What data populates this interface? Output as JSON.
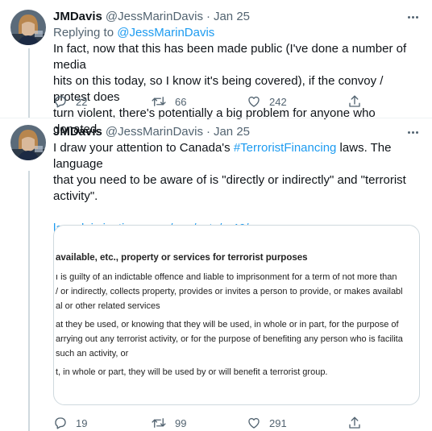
{
  "tweets": [
    {
      "author_name": "JMDavis",
      "author_handle": "@JessMarinDavis",
      "separator": "·",
      "date": "Jan 25",
      "replying_prefix": "Replying to",
      "replying_to": "@JessMarinDavis",
      "text_lines": [
        "In fact, now that this has been made public (I've done a number of media",
        "hits on this today, so I know it's being covered), if the convoy / protest does",
        "turn violent, there's potentially a big problem for anyone who donated."
      ],
      "replies": "22",
      "retweets": "66",
      "likes": "242"
    },
    {
      "author_name": "JMDavis",
      "author_handle": "@JessMarinDavis",
      "separator": "·",
      "date": "Jan 25",
      "text_part1": "I draw your attention to Canada's ",
      "hashtag": "#TerroristFinancing",
      "text_part2": " laws. The language",
      "text_line2": "that you need to be aware of is \"directly or indirectly\" and \"terrorist",
      "text_line3": "activity\".",
      "link": "laws-lois.justice.gc.ca/eng/acts/c-46/…",
      "replies": "19",
      "retweets": "99",
      "likes": "291",
      "card": {
        "heading": "available, etc., property or services for terrorist purposes",
        "lines": [
          "ı is guilty of an indictable offence and liable to imprisonment for a term of not more than",
          "/ or indirectly, collects property, provides or invites a person to provide, or makes availabl",
          "al or other related services",
          "at they be used, or knowing that they will be used, in whole or in part, for the purpose of",
          "arrying out any terrorist activity, or for the purpose of benefiting any person who is facilita",
          "such an activity, or",
          "t, in whole or part, they will be used by or will benefit a terrorist group."
        ]
      }
    }
  ],
  "colors": {
    "accent": "#1d9bf0",
    "muted": "#536471",
    "text": "#0f1419",
    "border": "#cfd9de"
  },
  "icons": [
    "avatar",
    "more-icon",
    "reply-icon",
    "retweet-icon",
    "like-icon",
    "share-icon"
  ]
}
